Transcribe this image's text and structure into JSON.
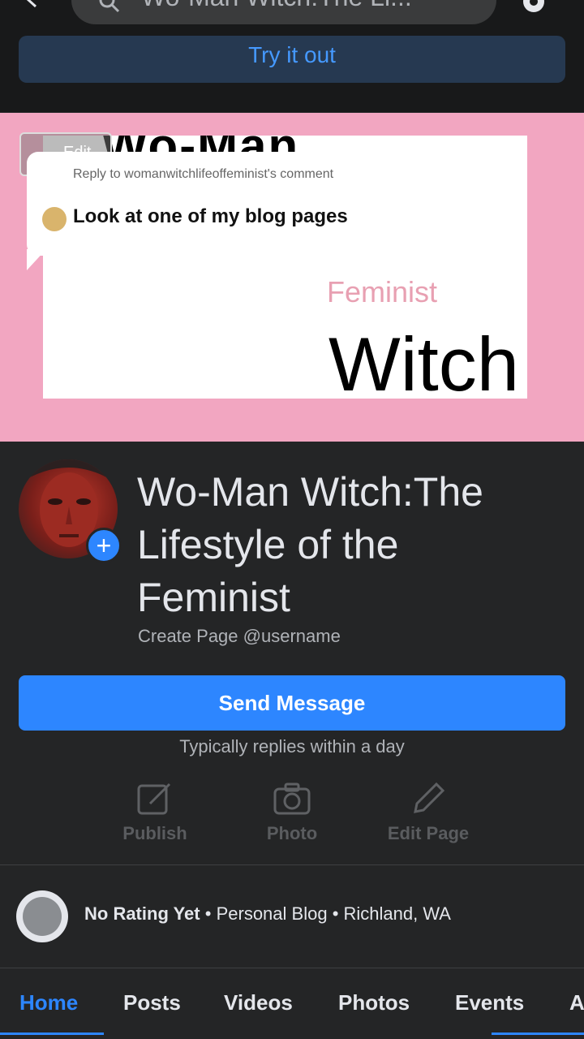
{
  "header": {
    "search_text": "Wo-Man Witch:The Li...",
    "try_it_out": "Try it out"
  },
  "cover": {
    "top_text": "Wo-Man",
    "feminist": "Feminist",
    "witch": "Witch",
    "edit_label": "Edit"
  },
  "comment_reply": {
    "meta": "Reply to womanwitchlifeoffeminist's comment",
    "text": "Look at one of my blog pages"
  },
  "page": {
    "title": "Wo-Man Witch:The Lifestyle of the Feminist",
    "username": "Create Page @username",
    "send_message": "Send Message",
    "reply_time": "Typically replies within a day"
  },
  "actions": [
    {
      "label": "Publish",
      "icon": "edit-square-icon"
    },
    {
      "label": "Photo",
      "icon": "camera-icon"
    },
    {
      "label": "Edit Page",
      "icon": "pencil-icon"
    }
  ],
  "info": {
    "rating": "No Rating Yet",
    "category": "Personal Blog",
    "location": "Richland, WA",
    "separator": "•"
  },
  "tabs": [
    "Home",
    "Posts",
    "Videos",
    "Photos",
    "Events",
    "A"
  ],
  "active_tab": "Home",
  "colors": {
    "background": "#242526",
    "accent": "#2d86ff",
    "cover": "#f2a6c1"
  }
}
